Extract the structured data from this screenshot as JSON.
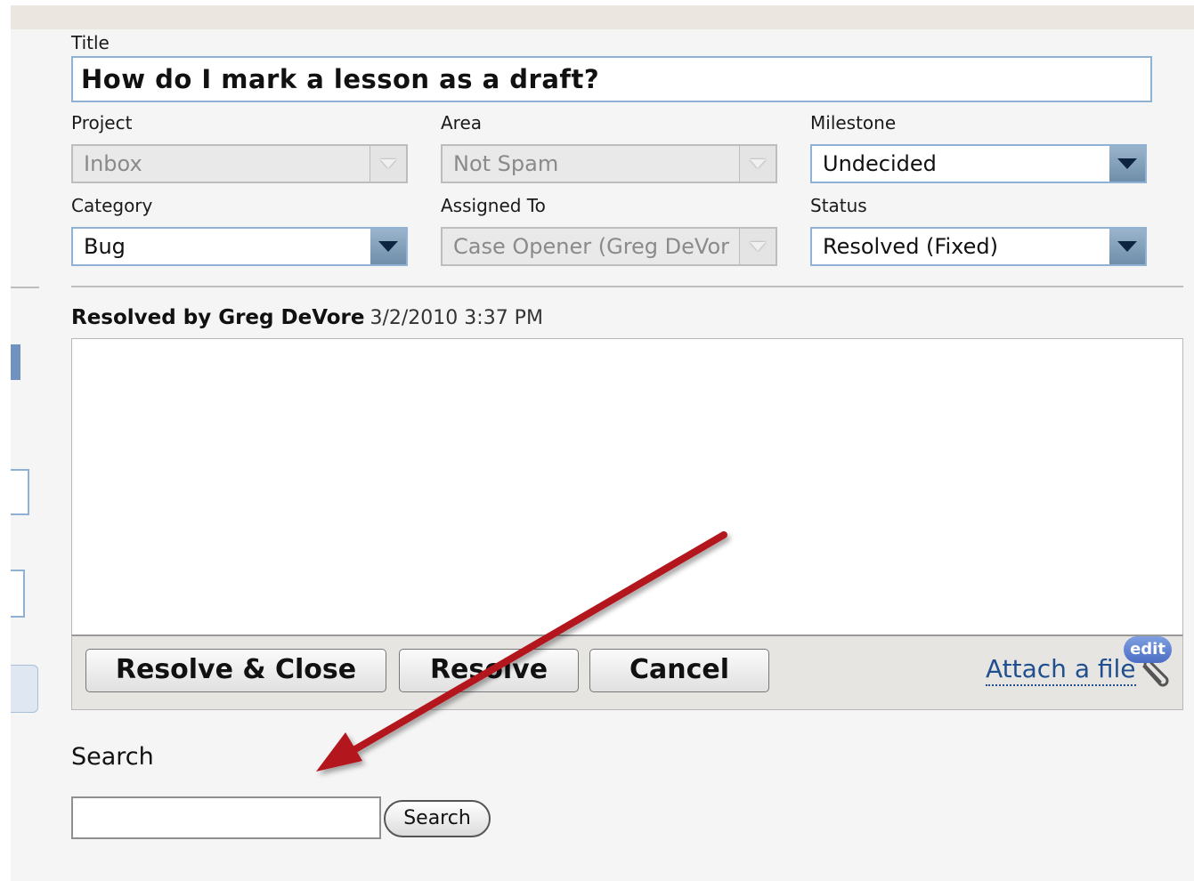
{
  "form": {
    "title_label": "Title",
    "title_value": "How do I mark a lesson as a draft?",
    "project": {
      "label": "Project",
      "value": "Inbox"
    },
    "area": {
      "label": "Area",
      "value": "Not Spam"
    },
    "milestone": {
      "label": "Milestone",
      "value": "Undecided"
    },
    "category": {
      "label": "Category",
      "value": "Bug"
    },
    "assigned_to": {
      "label": "Assigned To",
      "value": "Case Opener (Greg DeVor"
    },
    "status": {
      "label": "Status",
      "value": "Resolved (Fixed)"
    }
  },
  "resolution": {
    "header_bold": "Resolved by Greg DeVore",
    "timestamp": "3/2/2010 3:37 PM",
    "buttons": {
      "resolve_close": "Resolve & Close",
      "resolve": "Resolve",
      "cancel": "Cancel"
    },
    "attach_label": "Attach a file",
    "edit_badge": "edit"
  },
  "search": {
    "heading": "Search",
    "button_label": "Search"
  },
  "colors": {
    "accent_border": "#8fb1d4",
    "link": "#1f4f8e",
    "annotation_arrow": "#b3191c"
  },
  "icons": [
    "dropdown-arrow-icon",
    "paperclip-icon",
    "annotation-arrow"
  ]
}
